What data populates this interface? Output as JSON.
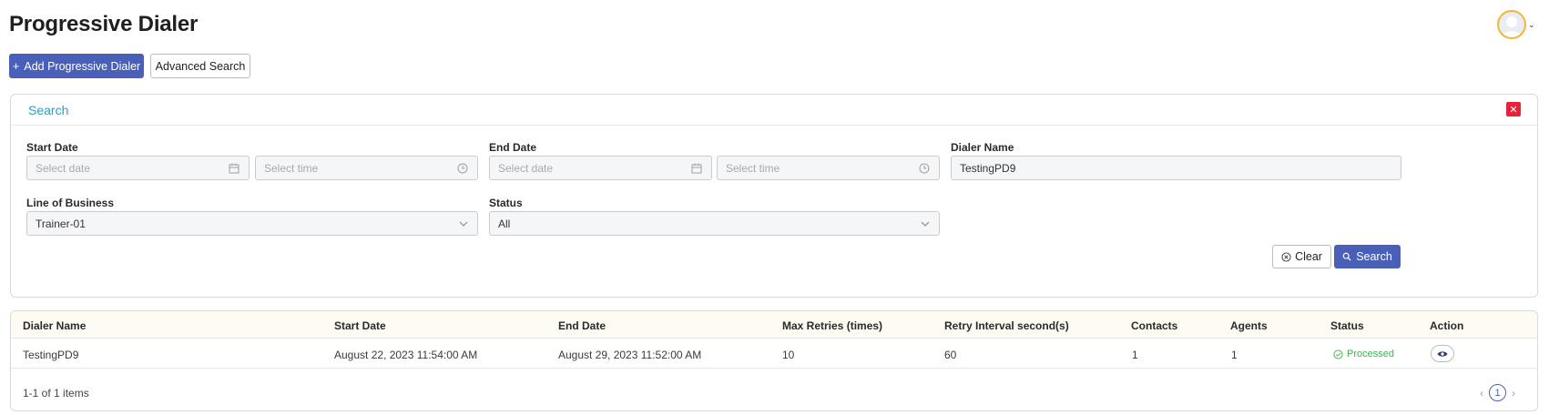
{
  "page": {
    "title": "Progressive Dialer"
  },
  "user": {
    "avatar": "user-avatar-icon"
  },
  "toolbar": {
    "add_label": "Add Progressive Dialer",
    "advanced_search_label": "Advanced Search"
  },
  "search": {
    "title": "Search",
    "start_date_label": "Start Date",
    "start_date_placeholder": "Select date",
    "start_time_placeholder": "Select time",
    "end_date_label": "End Date",
    "end_date_placeholder": "Select date",
    "end_time_placeholder": "Select time",
    "dialer_name_label": "Dialer Name",
    "dialer_name_value": "TestingPD9",
    "lob_label": "Line of Business",
    "lob_value": "Trainer-01",
    "status_label": "Status",
    "status_value": "All",
    "clear_label": "Clear",
    "search_label": "Search"
  },
  "table": {
    "columns": [
      "Dialer Name",
      "Start Date",
      "End Date",
      "Max Retries (times)",
      "Retry Interval second(s)",
      "Contacts",
      "Agents",
      "Status",
      "Action"
    ],
    "rows": [
      {
        "dialer_name": "TestingPD9",
        "start_date": "August 22, 2023 11:54:00 AM",
        "end_date": "August 29, 2023 11:52:00 AM",
        "max_retries": "10",
        "retry_interval": "60",
        "contacts": "1",
        "agents": "1",
        "status": "Processed"
      }
    ],
    "footer": "1-1 of 1 items",
    "current_page": "1"
  },
  "colors": {
    "primary": "#4a5fb8",
    "search_title": "#1aa3d6",
    "close": "#e8223b",
    "processed": "#3cb44b"
  }
}
